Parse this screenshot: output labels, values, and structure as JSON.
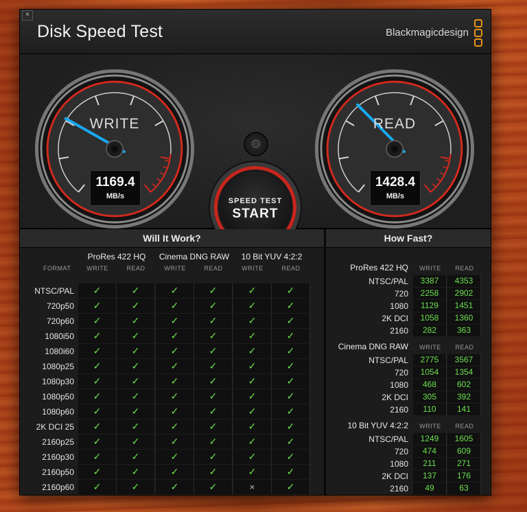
{
  "window": {
    "close_glyph": "×",
    "title": "Disk Speed Test",
    "brand": "Blackmagicdesign"
  },
  "gauges": {
    "write": {
      "label": "WRITE",
      "value": "1169.4",
      "unit": "MB/s"
    },
    "read": {
      "label": "READ",
      "value": "1428.4",
      "unit": "MB/s"
    }
  },
  "controls": {
    "gear_icon": "gear-icon",
    "start_small": "SPEED TEST",
    "start_big": "START"
  },
  "will_it_work": {
    "title": "Will It Work?",
    "format_header": "FORMAT",
    "groups": [
      {
        "name": "ProRes 422 HQ",
        "write": "WRITE",
        "read": "READ"
      },
      {
        "name": "Cinema DNG RAW",
        "write": "WRITE",
        "read": "READ"
      },
      {
        "name": "10 Bit YUV 4:2:2",
        "write": "WRITE",
        "read": "READ"
      }
    ],
    "rows": [
      {
        "format": "NTSC/PAL",
        "cells": [
          "✓",
          "✓",
          "✓",
          "✓",
          "✓",
          "✓"
        ]
      },
      {
        "format": "720p50",
        "cells": [
          "✓",
          "✓",
          "✓",
          "✓",
          "✓",
          "✓"
        ]
      },
      {
        "format": "720p60",
        "cells": [
          "✓",
          "✓",
          "✓",
          "✓",
          "✓",
          "✓"
        ]
      },
      {
        "format": "1080i50",
        "cells": [
          "✓",
          "✓",
          "✓",
          "✓",
          "✓",
          "✓"
        ]
      },
      {
        "format": "1080i60",
        "cells": [
          "✓",
          "✓",
          "✓",
          "✓",
          "✓",
          "✓"
        ]
      },
      {
        "format": "1080p25",
        "cells": [
          "✓",
          "✓",
          "✓",
          "✓",
          "✓",
          "✓"
        ]
      },
      {
        "format": "1080p30",
        "cells": [
          "✓",
          "✓",
          "✓",
          "✓",
          "✓",
          "✓"
        ]
      },
      {
        "format": "1080p50",
        "cells": [
          "✓",
          "✓",
          "✓",
          "✓",
          "✓",
          "✓"
        ]
      },
      {
        "format": "1080p60",
        "cells": [
          "✓",
          "✓",
          "✓",
          "✓",
          "✓",
          "✓"
        ]
      },
      {
        "format": "2K DCI 25",
        "cells": [
          "✓",
          "✓",
          "✓",
          "✓",
          "✓",
          "✓"
        ]
      },
      {
        "format": "2160p25",
        "cells": [
          "✓",
          "✓",
          "✓",
          "✓",
          "✓",
          "✓"
        ]
      },
      {
        "format": "2160p30",
        "cells": [
          "✓",
          "✓",
          "✓",
          "✓",
          "✓",
          "✓"
        ]
      },
      {
        "format": "2160p50",
        "cells": [
          "✓",
          "✓",
          "✓",
          "✓",
          "✓",
          "✓"
        ]
      },
      {
        "format": "2160p60",
        "cells": [
          "✓",
          "✓",
          "✓",
          "✓",
          "×",
          "✓"
        ]
      }
    ]
  },
  "how_fast": {
    "title": "How Fast?",
    "blocks": [
      {
        "name": "ProRes 422 HQ",
        "write": "WRITE",
        "read": "READ",
        "rows": [
          {
            "format": "NTSC/PAL",
            "write": "3387",
            "read": "4353"
          },
          {
            "format": "720",
            "write": "2258",
            "read": "2902"
          },
          {
            "format": "1080",
            "write": "1129",
            "read": "1451"
          },
          {
            "format": "2K DCI",
            "write": "1058",
            "read": "1360"
          },
          {
            "format": "2160",
            "write": "282",
            "read": "363"
          }
        ]
      },
      {
        "name": "Cinema DNG RAW",
        "write": "WRITE",
        "read": "READ",
        "rows": [
          {
            "format": "NTSC/PAL",
            "write": "2775",
            "read": "3567"
          },
          {
            "format": "720",
            "write": "1054",
            "read": "1354"
          },
          {
            "format": "1080",
            "write": "468",
            "read": "602"
          },
          {
            "format": "2K DCI",
            "write": "305",
            "read": "392"
          },
          {
            "format": "2160",
            "write": "110",
            "read": "141"
          }
        ]
      },
      {
        "name": "10 Bit YUV 4:2:2",
        "write": "WRITE",
        "read": "READ",
        "rows": [
          {
            "format": "NTSC/PAL",
            "write": "1249",
            "read": "1605"
          },
          {
            "format": "720",
            "write": "474",
            "read": "609"
          },
          {
            "format": "1080",
            "write": "211",
            "read": "271"
          },
          {
            "format": "2K DCI",
            "write": "137",
            "read": "176"
          },
          {
            "format": "2160",
            "write": "49",
            "read": "63"
          }
        ]
      }
    ]
  },
  "colors": {
    "check_green": "#6be04f",
    "needle_blue": "#19a9f0",
    "gauge_red": "#d12a1e",
    "accent_orange": "#e8941a"
  }
}
